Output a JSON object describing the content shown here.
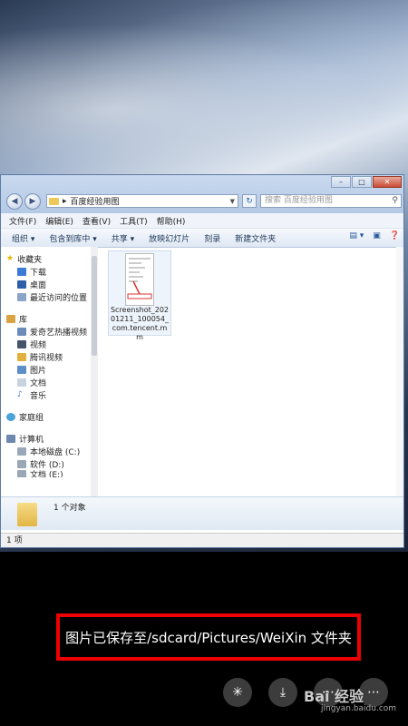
{
  "explorer": {
    "address": "百度经验用图",
    "search_placeholder": "搜索 百度经验用图",
    "window_controls": [
      "minimize-icon",
      "maximize-icon",
      "close-icon"
    ],
    "menu": [
      "文件(F)",
      "编辑(E)",
      "查看(V)",
      "工具(T)",
      "帮助(H)"
    ],
    "toolbar": [
      "组织 ▾",
      "包含到库中 ▾",
      "共享 ▾",
      "放映幻灯片",
      "刻录",
      "新建文件夹"
    ],
    "nav": {
      "favorites": {
        "title": "收藏夹",
        "items": [
          "下载",
          "桌面",
          "最近访问的位置"
        ]
      },
      "libraries": {
        "title": "库",
        "items": [
          "爱奇艺热播视频",
          "视频",
          "腾讯视频",
          "图片",
          "文档",
          "音乐"
        ]
      },
      "homegroup": "家庭组",
      "computer": {
        "title": "计算机",
        "items": [
          "本地磁盘 (C:)",
          "软件 (D:)",
          "文档 (E:)"
        ]
      }
    },
    "file": {
      "name": "Screenshot_20201211_100054_com.tencent.mm"
    },
    "details_count": "1 个对象",
    "status": "1 项"
  },
  "toast": "图片已保存至/sdcard/Pictures/WeiXin 文件夹",
  "actions": [
    "spark-icon",
    "download-icon",
    "more-icon",
    "more-icon-2"
  ],
  "watermark": {
    "brand": "Bai 经验",
    "url": "jingyan.baidu.com"
  }
}
